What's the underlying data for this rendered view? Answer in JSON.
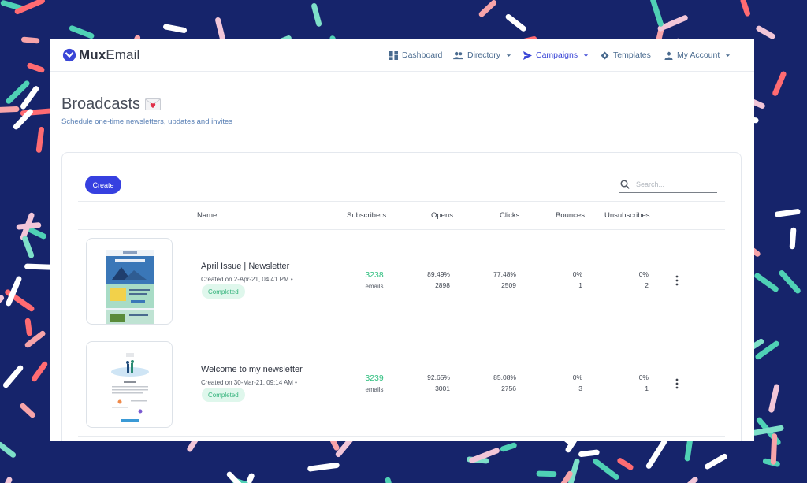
{
  "brand": {
    "name_bold": "Mux",
    "name_rest": "Email",
    "accent": "#3a46d6"
  },
  "nav": [
    {
      "label": "Dashboard",
      "icon": "dashboard-icon"
    },
    {
      "label": "Directory",
      "icon": "people-icon"
    },
    {
      "label": "Campaigns",
      "icon": "send-icon",
      "active": true
    },
    {
      "label": "Templates",
      "icon": "templates-icon"
    },
    {
      "label": "My Account",
      "icon": "person-icon"
    }
  ],
  "page": {
    "title": "Broadcasts",
    "subtitle": "Schedule one-time newsletters, updates and invites"
  },
  "toolbar": {
    "create_label": "Create",
    "search_placeholder": "Search..."
  },
  "table": {
    "headers": [
      "Name",
      "Subscribers",
      "Opens",
      "Clicks",
      "Bounces",
      "Unsubscribes"
    ],
    "rows": [
      {
        "name": "April Issue | Newsletter",
        "created": "Created on 2-Apr-21, 04:41 PM •",
        "status": "Completed",
        "subscribers": "3238",
        "subscribers_label": "emails",
        "opens_pct": "89.49%",
        "opens": "2898",
        "clicks_pct": "77.48%",
        "clicks": "2509",
        "bounces_pct": "0%",
        "bounces": "1",
        "unsubs_pct": "0%",
        "unsubs": "2"
      },
      {
        "name": "Welcome to my newsletter",
        "created": "Created on 30-Mar-21, 09:14 AM •",
        "status": "Completed",
        "subscribers": "3239",
        "subscribers_label": "emails",
        "opens_pct": "92.65%",
        "opens": "3001",
        "clicks_pct": "85.08%",
        "clicks": "2756",
        "bounces_pct": "0%",
        "bounces": "3",
        "unsubs_pct": "0%",
        "unsubs": "1"
      }
    ]
  },
  "colors": {
    "background": "#16246b",
    "completed": "#32b27a",
    "subscribers": "#2fbf7f",
    "create_button": "#3640e0"
  }
}
